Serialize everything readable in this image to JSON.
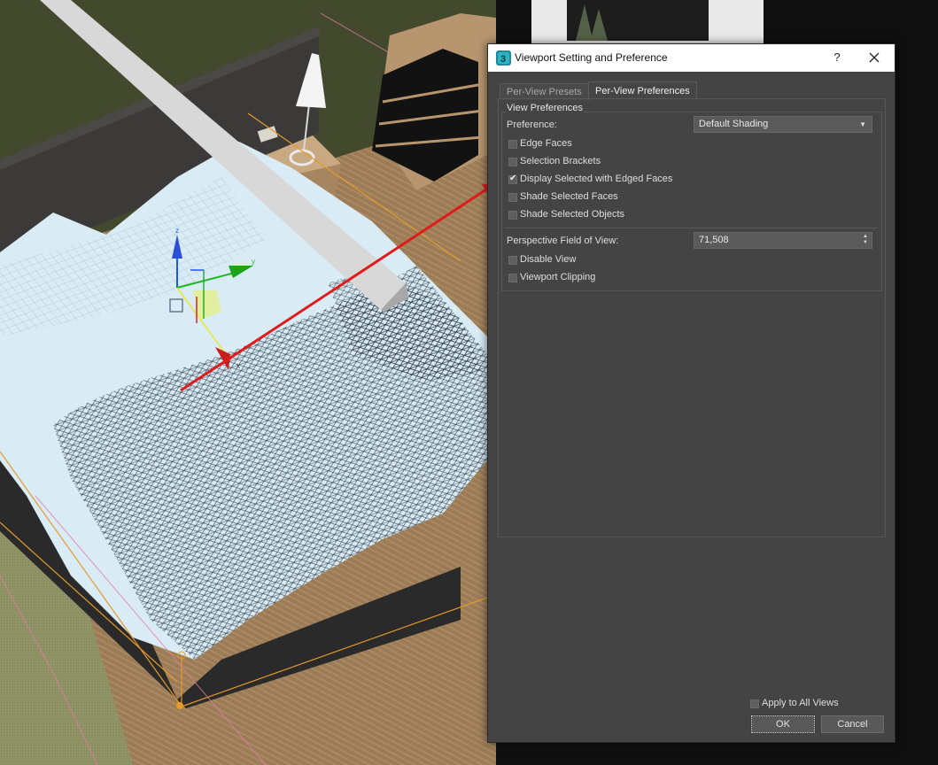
{
  "dialog": {
    "title": "Viewport Setting and Preference",
    "help_label": "?",
    "app_icon_label": "3",
    "tabs": [
      {
        "label": "Per-View Presets",
        "active": false
      },
      {
        "label": "Per-View Preferences",
        "active": true
      }
    ],
    "group_title": "View Preferences",
    "preference": {
      "label": "Preference:",
      "value": "Default Shading"
    },
    "checkboxes": [
      {
        "label": "Edge Faces",
        "checked": false
      },
      {
        "label": "Selection Brackets",
        "checked": false
      },
      {
        "label": "Display Selected with Edged Faces",
        "checked": true
      },
      {
        "label": "Shade Selected Faces",
        "checked": false
      },
      {
        "label": "Shade Selected Objects",
        "checked": false
      }
    ],
    "fov": {
      "label": "Perspective Field of View:",
      "value": "71,508"
    },
    "checkboxes2": [
      {
        "label": "Disable View",
        "checked": false
      },
      {
        "label": "Viewport Clipping",
        "checked": false
      }
    ],
    "apply_all": {
      "label": "Apply to All Views",
      "checked": false
    },
    "ok_label": "OK",
    "cancel_label": "Cancel",
    "check_glyph": "✔",
    "dropdown_glyph": "▼",
    "spinner_glyph_up": "▲",
    "spinner_glyph_down": "▼"
  },
  "gizmo_labels": {
    "z": "z",
    "y": "y",
    "x": "x"
  },
  "colors": {
    "accent_arrow": "#e01b1b",
    "wall": "#43492c",
    "floor": "#9c7c57",
    "sheet": "#d9ecf6",
    "dialog_bg": "#444444",
    "titlebar": "#ffffff"
  }
}
